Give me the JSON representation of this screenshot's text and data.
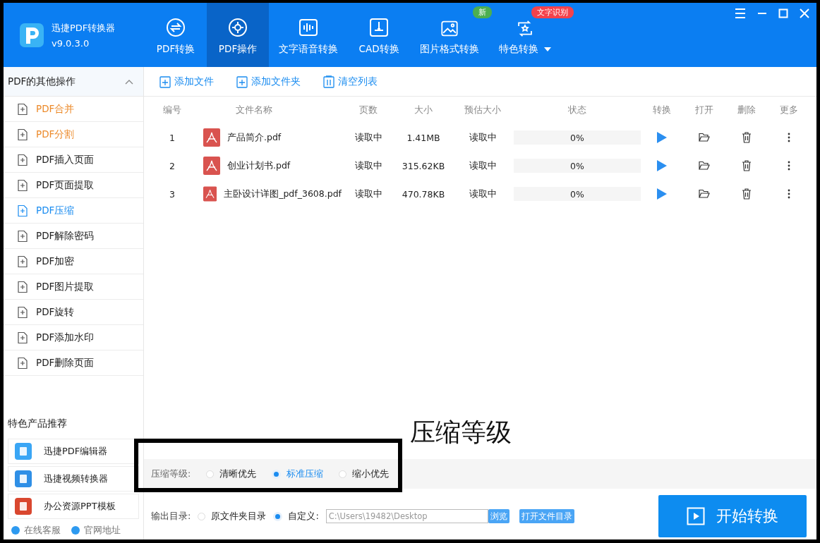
{
  "app": {
    "name": "迅捷PDF转换器",
    "version": "v9.0.3.0"
  },
  "nav_tabs": [
    {
      "label": "PDF转换",
      "selected": false
    },
    {
      "label": "PDF操作",
      "selected": true
    },
    {
      "label": "文字语音转换",
      "selected": false
    },
    {
      "label": "CAD转换",
      "selected": false
    },
    {
      "label": "图片格式转换",
      "selected": false,
      "badge": {
        "text": "新",
        "color": "#4caf50"
      }
    },
    {
      "label": "特色转换",
      "selected": false,
      "badge": {
        "text": "文字识别",
        "color": "#f4424c"
      },
      "dropdown": true
    }
  ],
  "sidebar": {
    "title": "PDF的其他操作",
    "expanded": true,
    "items": [
      {
        "label": "PDF合并",
        "selected": false,
        "visited": true
      },
      {
        "label": "PDF分割",
        "selected": false,
        "visited": true
      },
      {
        "label": "PDF插入页面",
        "selected": false,
        "visited": false
      },
      {
        "label": "PDF页面提取",
        "selected": false,
        "visited": false
      },
      {
        "label": "PDF压缩",
        "selected": true,
        "visited": false
      },
      {
        "label": "PDF解除密码",
        "selected": false,
        "visited": false
      },
      {
        "label": "PDF加密",
        "selected": false,
        "visited": false
      },
      {
        "label": "PDF图片提取",
        "selected": false,
        "visited": false
      },
      {
        "label": "PDF旋转",
        "selected": false,
        "visited": false
      },
      {
        "label": "PDF添加水印",
        "selected": false,
        "visited": false
      },
      {
        "label": "PDF删除页面",
        "selected": false,
        "visited": false
      }
    ],
    "recommend_title": "特色产品推荐",
    "products": [
      "迅捷PDF编辑器",
      "迅捷视频转换器",
      "办公资源PPT模板"
    ],
    "links": [
      "在线客服",
      "官网地址"
    ]
  },
  "toolbar": [
    "添加文件",
    "添加文件夹",
    "清空列表"
  ],
  "table": {
    "columns": [
      "编号",
      "文件名称",
      "页数",
      "大小",
      "预估大小",
      "状态",
      "转换",
      "打开",
      "删除",
      "更多"
    ],
    "rows": [
      {
        "index": "1",
        "name": "产品简介.pdf",
        "pages": "读取中",
        "size": "1.41MB",
        "estimate": "读取中",
        "status": "0%",
        "level": 0
      },
      {
        "index": "2",
        "name": "创业计划书.pdf",
        "pages": "读取中",
        "size": "315.62KB",
        "estimate": "读取中",
        "status": "0%",
        "level": 0
      },
      {
        "index": "3",
        "name": "主卧设计详图_pdf_3608.pdf",
        "pages": "读取中",
        "size": "470.78KB",
        "estimate": "读取中",
        "status": "0%",
        "level": 0
      }
    ]
  },
  "compression": {
    "label": "压缩等级:",
    "options": [
      {
        "label": "清晰优先",
        "selected": false
      },
      {
        "label": "标准压缩",
        "selected": true
      },
      {
        "label": "缩小优先",
        "selected": false
      }
    ]
  },
  "output": {
    "label": "输出目录:",
    "options": [
      {
        "label": "原文件夹目录",
        "selected": false
      },
      {
        "label": "自定义:",
        "selected": true
      }
    ],
    "path": "C:\\Users\\19482\\Desktop",
    "browse": "浏览",
    "open_folder": "打开文件目录"
  },
  "start_button": "开始转换",
  "annotation": {
    "label": "压缩等级"
  }
}
